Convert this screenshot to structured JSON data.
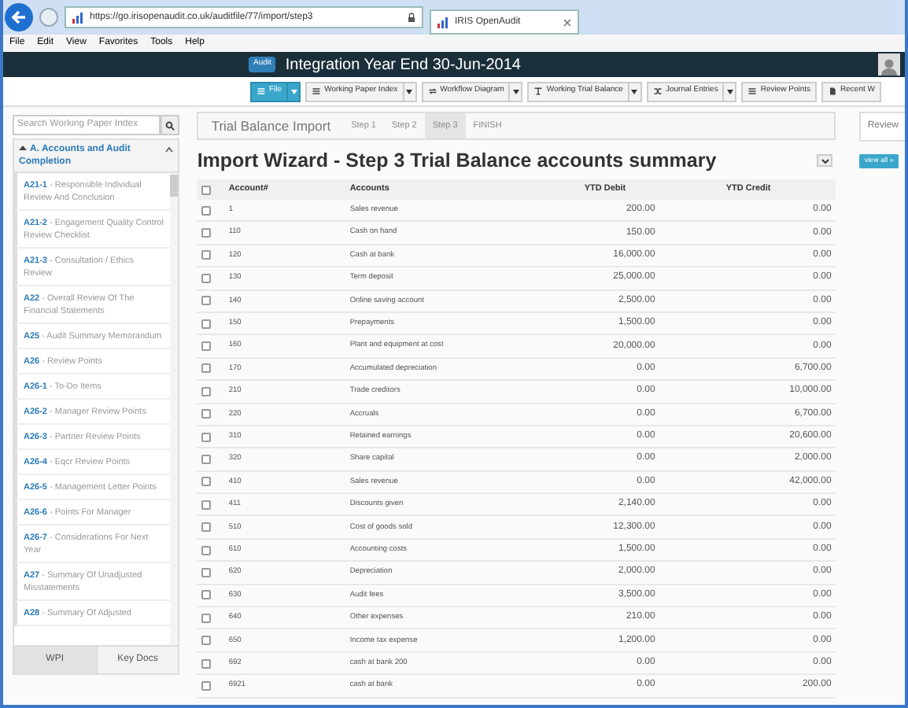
{
  "browser": {
    "url": "https://go.irisopenaudit.co.uk/auditfile/77/import/step3",
    "tab": "IRIS OpenAudit",
    "menu": [
      "File",
      "Edit",
      "View",
      "Favorites",
      "Tools",
      "Help"
    ]
  },
  "header": {
    "badge": "Audit",
    "title": "Integration Year End 30-Jun-2014"
  },
  "toolbar": [
    {
      "label": "File",
      "kind": "primary",
      "dropdown": true
    },
    {
      "label": "Working Paper Index",
      "kind": "list",
      "dropdown": true
    },
    {
      "label": "Workflow Diagram",
      "kind": "flow",
      "dropdown": true
    },
    {
      "label": "Working Trial Balance",
      "kind": "balance",
      "dropdown": true
    },
    {
      "label": "Journal Entries",
      "kind": "shuffle",
      "dropdown": true
    },
    {
      "label": "Review Points",
      "kind": "list",
      "dropdown": false
    },
    {
      "label": "Recent W",
      "kind": "doc",
      "dropdown": false
    }
  ],
  "sidebar": {
    "search_placeholder": "Search Working Paper Index",
    "section": {
      "title": "A. Accounts and Audit Completion",
      "expanded": true,
      "items": [
        {
          "text": "**A21-1** - Responsible Individual Review And Conclusion"
        },
        {
          "text": "**A21-2** - Engagement Quality Control Review Checklist"
        },
        {
          "text": "**A21-3** - Consultation / Ethics Review"
        },
        {
          "text": "**A22** - Overall Review Of The Financial Statements"
        },
        {
          "text": "**A25** - Audit Summary Memorandum"
        },
        {
          "text": "**A26** - Review Points"
        },
        {
          "text": "**A26-1** - To-Do Items"
        },
        {
          "text": "**A26-2** - Manager Review Points"
        },
        {
          "text": "**A26-3** - Partner Review Points"
        },
        {
          "text": "**A26-4** - Eqcr Review Points"
        },
        {
          "text": "**A26-5** - Management Letter Points"
        },
        {
          "text": "**A26-6** - Points For Manager"
        },
        {
          "text": "**A26-7** - Considerations For Next Year"
        },
        {
          "text": "**A27** - Summary Of Unadjusted Misstatements"
        },
        {
          "text": "**A28** - Summary Of Adjusted"
        }
      ]
    },
    "tabs": [
      {
        "label": "WPI",
        "selected": true
      },
      {
        "label": "Key Docs",
        "selected": false
      }
    ]
  },
  "wizard": {
    "title": "Trial Balance Import",
    "steps": [
      {
        "label": "Step 1",
        "selected": false
      },
      {
        "label": "Step 2",
        "selected": false
      },
      {
        "label": "Step 3",
        "selected": true
      },
      {
        "label": "FINISH",
        "selected": false
      }
    ]
  },
  "heading": "Import Wizard - Step 3 Trial Balance accounts summary",
  "table": {
    "columns": [
      "Account#",
      "Accounts",
      "YTD Debit",
      "YTD Credit"
    ],
    "all_checked": false,
    "rows": [
      {
        "account": "1",
        "name": "Sales revenue",
        "debit": "200.00",
        "credit": "0.00",
        "checked": false
      },
      {
        "account": "110",
        "name": "Cash on hand",
        "debit": "150.00",
        "credit": "0.00",
        "checked": false
      },
      {
        "account": "120",
        "name": "Cash at bank",
        "debit": "16,000.00",
        "credit": "0.00",
        "checked": false
      },
      {
        "account": "130",
        "name": "Term deposit",
        "debit": "25,000.00",
        "credit": "0.00",
        "checked": false
      },
      {
        "account": "140",
        "name": "Online saving account",
        "debit": "2,500.00",
        "credit": "0.00",
        "checked": false
      },
      {
        "account": "150",
        "name": "Prepayments",
        "debit": "1,500.00",
        "credit": "0.00",
        "checked": false
      },
      {
        "account": "160",
        "name": "Plant and equipment at cost",
        "debit": "20,000.00",
        "credit": "0.00",
        "checked": false
      },
      {
        "account": "170",
        "name": "Accumulated depreciation",
        "debit": "0.00",
        "credit": "6,700.00",
        "checked": false
      },
      {
        "account": "210",
        "name": "Trade creditors",
        "debit": "0.00",
        "credit": "10,000.00",
        "checked": false
      },
      {
        "account": "220",
        "name": "Accruals",
        "debit": "0.00",
        "credit": "6,700.00",
        "checked": false
      },
      {
        "account": "310",
        "name": "Retained earnings",
        "debit": "0.00",
        "credit": "20,600.00",
        "checked": false
      },
      {
        "account": "320",
        "name": "Share capital",
        "debit": "0.00",
        "credit": "2,000.00",
        "checked": false
      },
      {
        "account": "410",
        "name": "Sales revenue",
        "debit": "0.00",
        "credit": "42,000.00",
        "checked": false
      },
      {
        "account": "411",
        "name": "Discounts given",
        "debit": "2,140.00",
        "credit": "0.00",
        "checked": false
      },
      {
        "account": "510",
        "name": "Cost of goods sold",
        "debit": "12,300.00",
        "credit": "0.00",
        "checked": false
      },
      {
        "account": "610",
        "name": "Accounting costs",
        "debit": "1,500.00",
        "credit": "0.00",
        "checked": false
      },
      {
        "account": "620",
        "name": "Depreciation",
        "debit": "2,000.00",
        "credit": "0.00",
        "checked": false
      },
      {
        "account": "630",
        "name": "Audit fees",
        "debit": "3,500.00",
        "credit": "0.00",
        "checked": false
      },
      {
        "account": "640",
        "name": "Other expenses",
        "debit": "210.00",
        "credit": "0.00",
        "checked": false
      },
      {
        "account": "650",
        "name": "Income tax expense",
        "debit": "1,200.00",
        "credit": "0.00",
        "checked": false
      },
      {
        "account": "692",
        "name": "cash at bank 200",
        "debit": "0.00",
        "credit": "0.00",
        "checked": false
      },
      {
        "account": "6921",
        "name": "cash at bank",
        "debit": "0.00",
        "credit": "200.00",
        "checked": false
      }
    ]
  },
  "right_panel": {
    "tab": "Review",
    "button": "view all »"
  }
}
